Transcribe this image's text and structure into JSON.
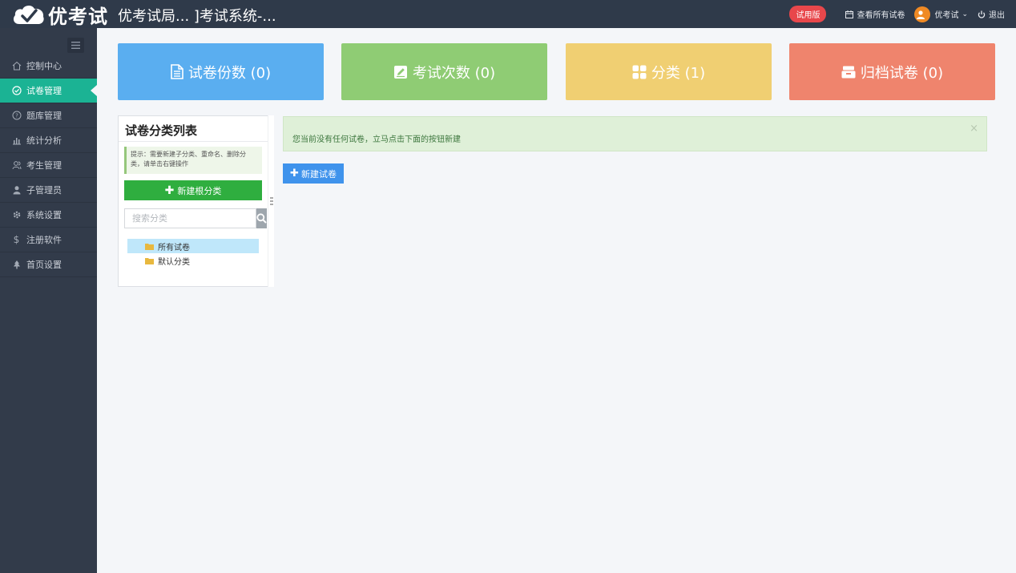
{
  "header": {
    "logo_text": "优考试",
    "app_title": "优考试局...  ]考试系统-...",
    "trial_badge": "试用版",
    "view_all_papers": "查看所有试卷",
    "user_name": "优考试",
    "logout": "退出"
  },
  "sidebar": {
    "items": [
      {
        "label": "控制中心",
        "icon": "home-icon"
      },
      {
        "label": "试卷管理",
        "icon": "check-circle-icon",
        "active": true
      },
      {
        "label": "题库管理",
        "icon": "question-circle-icon"
      },
      {
        "label": "统计分析",
        "icon": "bar-chart-icon"
      },
      {
        "label": "考生管理",
        "icon": "users-icon"
      },
      {
        "label": "子管理员",
        "icon": "user-icon"
      },
      {
        "label": "系统设置",
        "icon": "gear-icon"
      },
      {
        "label": "注册软件",
        "icon": "dollar-icon"
      },
      {
        "label": "首页设置",
        "icon": "tree-icon"
      }
    ]
  },
  "stats": {
    "papers": "试卷份数 (0)",
    "exams": "考试次数 (0)",
    "categories": "分类 (1)",
    "archived": "归档试卷 (0)"
  },
  "category_panel": {
    "title": "试卷分类列表",
    "hint": "提示：需要新建子分类、重命名、删除分类，请单击右键操作",
    "new_root_button": "新建根分类",
    "search_placeholder": "搜索分类",
    "tree": [
      "所有试卷",
      "默认分类"
    ]
  },
  "alert": {
    "message": "您当前没有任何试卷，立马点击下面的按钮新建",
    "close": "×"
  },
  "new_paper_button": "新建试卷",
  "colors": {
    "topbar": "#2f3a4a",
    "sidebar": "#323b4a",
    "active": "#1bb394",
    "card_blue": "#5aaef0",
    "card_green": "#8fcc74",
    "card_yellow": "#f0cf72",
    "card_red": "#ef846d"
  }
}
